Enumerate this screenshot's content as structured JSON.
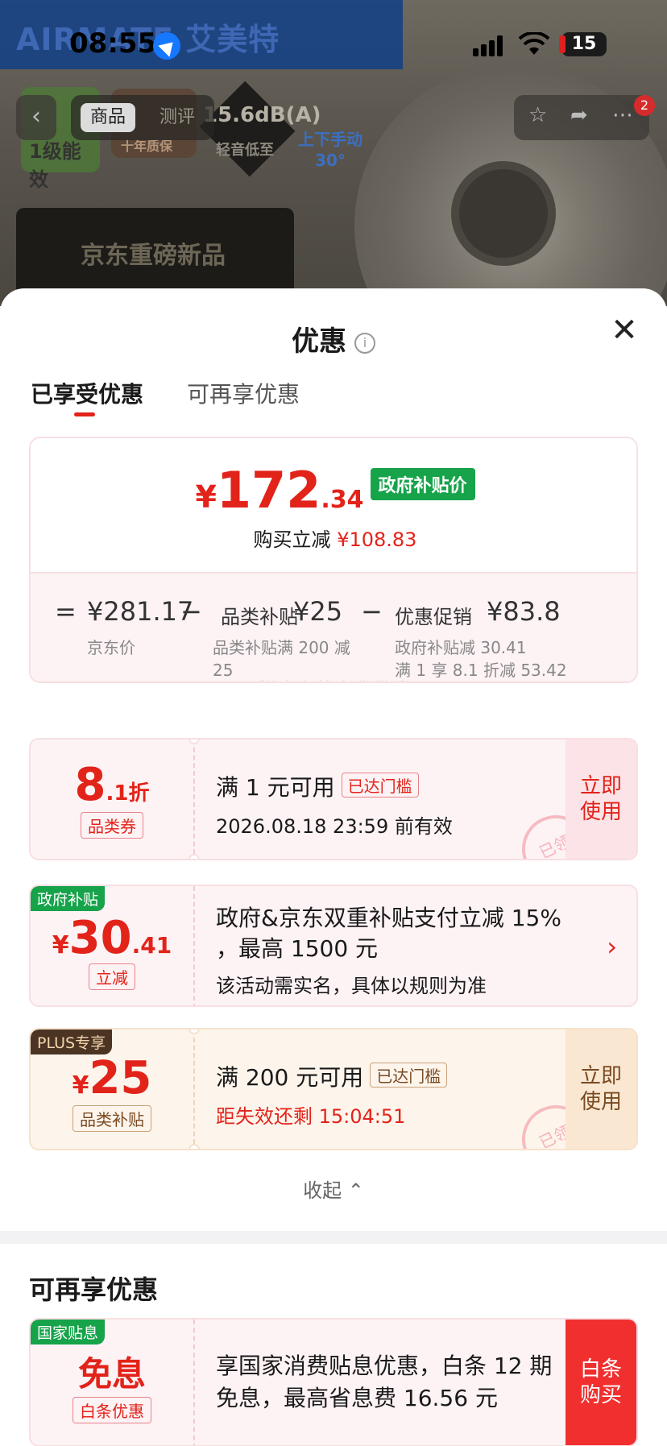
{
  "status_bar": {
    "time": "08:55",
    "battery": "15"
  },
  "background_page": {
    "brand": "AIRMATE 艾美特",
    "top_nav": {
      "back": "‹",
      "tab_goods": "商品",
      "tab_review": "测评",
      "cart_badge": "2"
    },
    "promo": {
      "energy_label": "1级能效",
      "quality_label": "十年质保",
      "quiet_label": "15.6dB(A)",
      "quiet_sub": "轻音低至",
      "fan_label": "上下手动\n30°",
      "new_product": "京东重磅新品"
    }
  },
  "sheet": {
    "title": "优惠",
    "close": "✕",
    "tabs": [
      {
        "label": "已享受优惠",
        "active": true
      },
      {
        "label": "可再享优惠",
        "active": false
      }
    ],
    "summary": {
      "currency": "¥",
      "price_int": "172",
      "price_dec": ".34",
      "price_tag": "政府补贴价",
      "reduce_label": "购买立减",
      "reduce_amount": "¥108.83",
      "eq": "=",
      "jd_price": "¥281.17",
      "jd_price_label": "京东价",
      "minus1": "−",
      "category_label": "品类补贴",
      "category_amount": "¥25",
      "category_sub": "品类补贴满 200 减\n25",
      "minus2": "−",
      "promo_label": "优惠促销",
      "promo_amount": "¥83.8",
      "promo_sub1": "政府补贴减 30.41",
      "promo_sub2": "满 1 享 8.1 折减 53.42",
      "watermark": "脚尖上的老叟数案"
    },
    "coupons": [
      {
        "value_int": "8",
        "value_dec": ".1折",
        "label": "品类券",
        "title": "满 1 元可用",
        "reached": "已达门槛",
        "subtitle": "2026.08.18 23:59 前有效",
        "action": "立即\n使用",
        "stamp": "已领"
      },
      {
        "corner": "政府补贴",
        "currency": "¥",
        "value_int": "30",
        "value_dec": ".41",
        "label": "立减",
        "title": "政府&京东双重补贴支付立减 15%",
        "title2": "，最高 1500 元",
        "subtitle": "该活动需实名，具体以规则为准",
        "chevron": "›"
      },
      {
        "corner": "PLUS专享",
        "currency": "¥",
        "value_int": "25",
        "label": "品类补贴",
        "title": "满 200 元可用",
        "reached": "已达门槛",
        "subtitle": "距失效还剩 15:04:51",
        "action": "立即\n使用",
        "stamp": "已领"
      }
    ],
    "collapse": "收起 ⌃",
    "more_section_title": "可再享优惠",
    "loan_coupon": {
      "corner": "国家贴息",
      "value": "免息",
      "label": "白条优惠",
      "text": "享国家消费贴息优惠，白条 12 期免息，最高省息费 16.56 元",
      "action": "白条\n购买"
    }
  }
}
